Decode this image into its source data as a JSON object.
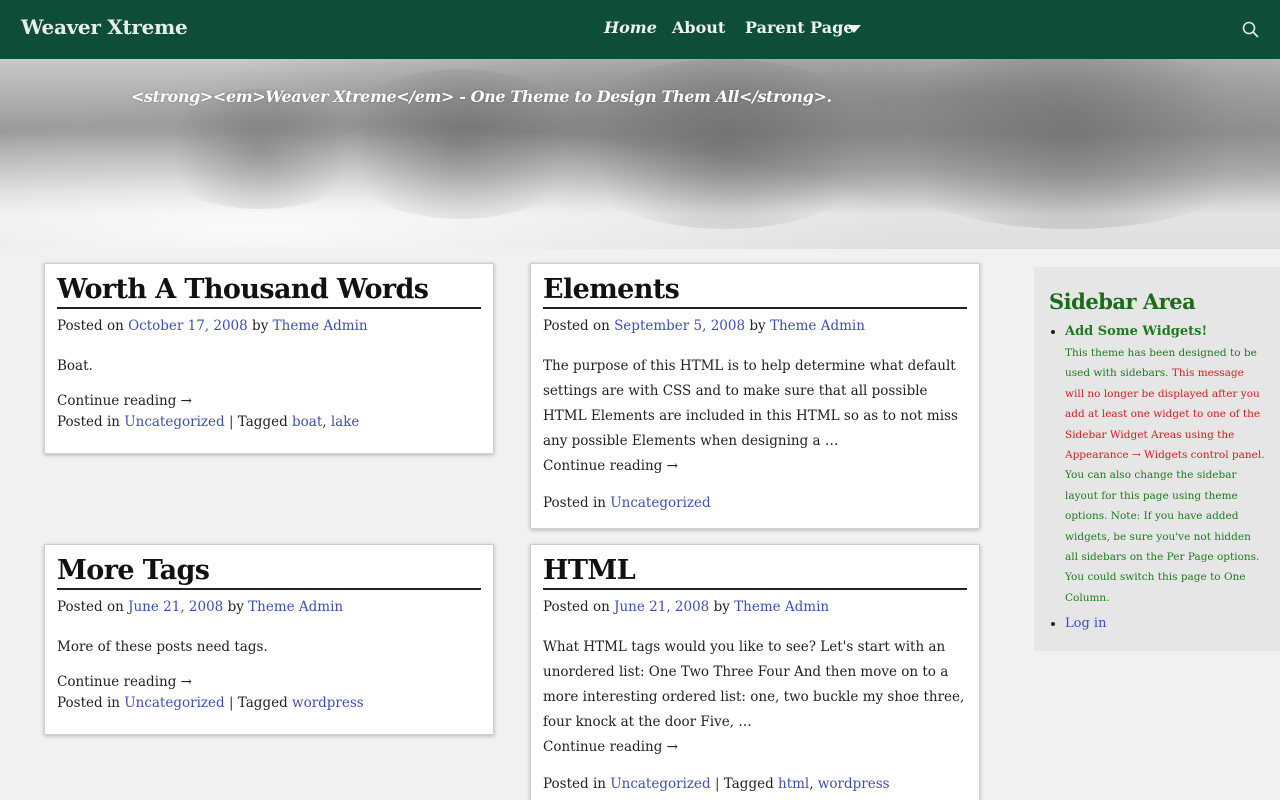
{
  "header": {
    "site_title": "Weaver Xtreme",
    "nav": {
      "home": "Home",
      "about": "About",
      "parent": "Parent Page"
    },
    "tagline": "<strong><em>Weaver Xtreme</em> - One Theme to Design Them All</strong>."
  },
  "posts": [
    {
      "title": "Worth A Thousand Words",
      "posted_on": "Posted on",
      "date": "October 17, 2008",
      "by": "by",
      "author": "Theme Admin",
      "excerpt": "Boat.",
      "continue": "Continue reading →",
      "posted_in": "Posted in",
      "category": "Uncategorized",
      "sep": "|",
      "tagged": "Tagged",
      "tag1": "boat",
      "comma": ",",
      "tag2": "lake"
    },
    {
      "title": "Elements",
      "posted_on": "Posted on",
      "date": "September 5, 2008",
      "by": "by",
      "author": "Theme Admin",
      "excerpt": "The purpose of this HTML is to help determine what default settings are with CSS and to make sure that all possible HTML Elements are included in this HTML so as to not miss any possible Elements when designing a …",
      "continue": "Continue reading →",
      "posted_in": "Posted in",
      "category": "Uncategorized"
    },
    {
      "title": "More Tags",
      "posted_on": "Posted on",
      "date": "June 21, 2008",
      "by": "by",
      "author": "Theme Admin",
      "excerpt": "More of these posts need tags.",
      "continue": "Continue reading →",
      "posted_in": "Posted in",
      "category": "Uncategorized",
      "sep": "|",
      "tagged": "Tagged",
      "tag1": "wordpress"
    },
    {
      "title": "HTML",
      "posted_on": "Posted on",
      "date": "June 21, 2008",
      "by": "by",
      "author": "Theme Admin",
      "excerpt": "What HTML tags would you like to see? Let's start with an unordered list: One Two Three Four And then move on to a more interesting ordered list: one, two buckle my shoe three, four knock at the door Five, …",
      "continue": "Continue reading →",
      "posted_in": "Posted in",
      "category": "Uncategorized",
      "sep": "|",
      "tagged": "Tagged",
      "tag1": "html",
      "comma": ",",
      "tag2": "wordpress"
    }
  ],
  "sidebar": {
    "title": "Sidebar Area",
    "add_widgets": "Add Some Widgets!",
    "text_green1": "This theme has been designed to be used with sidebars.",
    "text_red": "This message will no longer be displayed after you add at least one widget to one of the Sidebar Widget Areas using the Appearance → Widgets control panel.",
    "text_green2": "You can also change the sidebar layout for this page using theme options.",
    "text_green3": "Note: If you have added widgets, be sure you've not hidden all sidebars on the Per Page options. You could switch this page to One Column.",
    "login": "Log in"
  },
  "colors": {
    "header_bg": "#0f4d3b",
    "link": "#3d4fb6",
    "sidebar_title": "#1b6b1b",
    "sidebar_warning": "#d42020"
  }
}
